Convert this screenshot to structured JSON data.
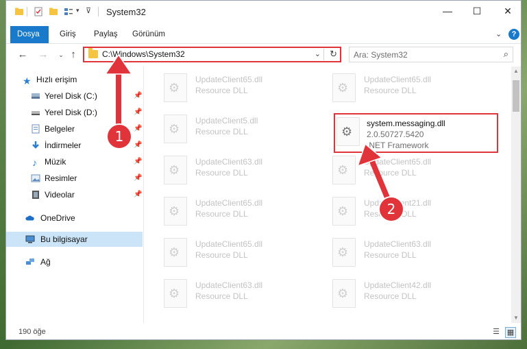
{
  "window": {
    "title": "System32"
  },
  "ribbon": {
    "tabs": [
      "Dosya",
      "Giriş",
      "Paylaş",
      "Görünüm"
    ]
  },
  "address": {
    "path": "C:\\Windows\\System32"
  },
  "search": {
    "placeholder": "Ara: System32"
  },
  "sidebar": {
    "items": [
      {
        "label": "Hızlı erişim",
        "icon": "star-icon",
        "pinned": false
      },
      {
        "label": "Yerel Disk (C:)",
        "icon": "drive-icon",
        "pinned": true
      },
      {
        "label": "Yerel Disk (D:)",
        "icon": "drive-icon",
        "pinned": true
      },
      {
        "label": "Belgeler",
        "icon": "document-icon",
        "pinned": true
      },
      {
        "label": "İndirmeler",
        "icon": "download-icon",
        "pinned": true
      },
      {
        "label": "Müzik",
        "icon": "music-icon",
        "pinned": true
      },
      {
        "label": "Resimler",
        "icon": "pictures-icon",
        "pinned": true
      },
      {
        "label": "Videolar",
        "icon": "video-icon",
        "pinned": true
      },
      {
        "label": "OneDrive",
        "icon": "cloud-icon",
        "pinned": false
      },
      {
        "label": "Bu bilgisayar",
        "icon": "computer-icon",
        "pinned": false
      },
      {
        "label": "Ağ",
        "icon": "network-icon",
        "pinned": false
      }
    ]
  },
  "files": {
    "left": [
      {
        "name": "UpdateClient65.dll",
        "desc": "Resource DLL"
      },
      {
        "name": "UpdateClient5.dll",
        "desc": "Resource DLL"
      },
      {
        "name": "UpdateClient63.dll",
        "desc": "Resource DLL"
      },
      {
        "name": "UpdateClient65.dll",
        "desc": "Resource DLL"
      },
      {
        "name": "UpdateClient65.dll",
        "desc": "Resource DLL"
      },
      {
        "name": "UpdateClient63.dll",
        "desc": "Resource DLL"
      }
    ],
    "right": [
      {
        "name": "UpdateClient65.dll",
        "desc": "Resource DLL"
      },
      {
        "name": "UpdateClient65.dll",
        "desc": "Resource DLL"
      },
      {
        "name": "UpdateClient21.dll",
        "desc": "Resource DLL"
      },
      {
        "name": "UpdateClient63.dll",
        "desc": "Resource DLL"
      },
      {
        "name": "UpdateClient42.dll",
        "desc": "Resource DLL"
      }
    ],
    "highlighted": {
      "name": "system.messaging.dll",
      "version": "2.0.50727.5420",
      "company": ".NET Framework"
    }
  },
  "status": {
    "count": "190 öğe"
  },
  "annotations": {
    "badge1": "1",
    "badge2": "2",
    "color": "#e0333a"
  }
}
